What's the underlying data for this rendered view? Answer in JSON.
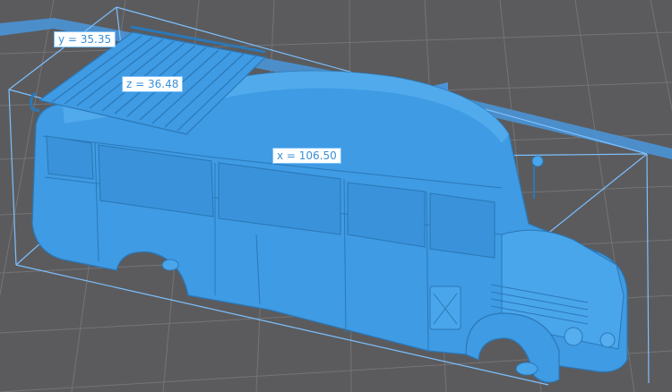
{
  "viewport": {
    "background_color": "#5b5b5d",
    "grid_color": "#777779",
    "model_color": "#3f9be3",
    "bounding_box_color": "#7cc0ff",
    "build_plate_edge_color": "#4a93d6"
  },
  "dimensions": {
    "x_label": "x = 106.50",
    "y_label": "y = 35.35",
    "z_label": "z = 36.48"
  },
  "model": {
    "name": "bus-model"
  }
}
